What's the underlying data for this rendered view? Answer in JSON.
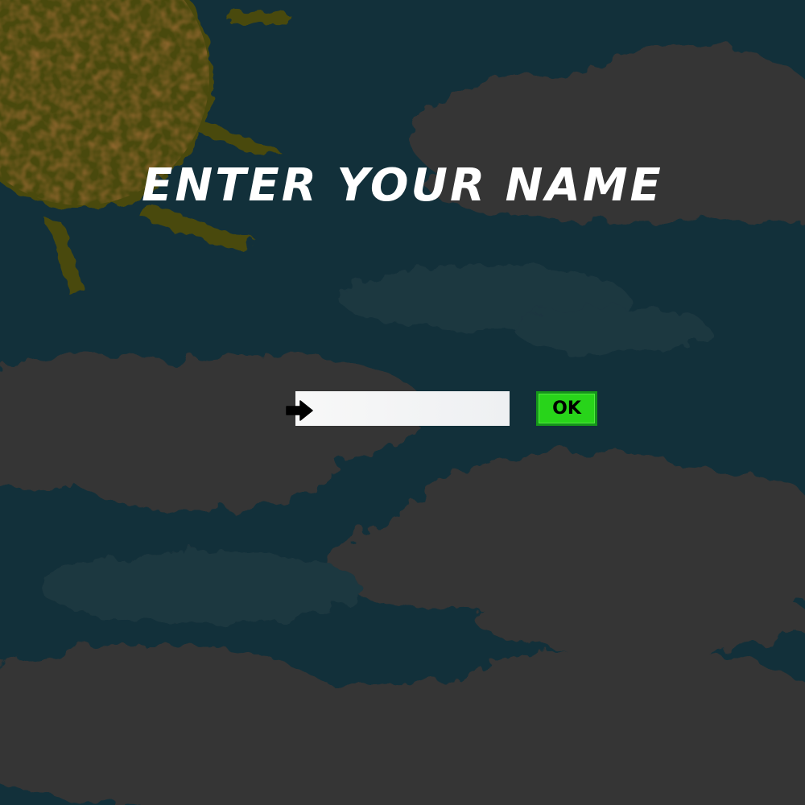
{
  "screen": {
    "title": "ENTER YOUR NAME"
  },
  "name_form": {
    "input_value": "",
    "input_placeholder": "",
    "ok_label": "OK",
    "cursor_icon": "pointing-hand-cursor-icon"
  },
  "colors": {
    "sky": "#12303a",
    "cloud": "#353535",
    "sun": "#4a4a10",
    "title_text": "#ffffff",
    "input_background": "#f2f3f4",
    "ok_button_fill": "#28d41a",
    "ok_button_border": "#15961a"
  }
}
